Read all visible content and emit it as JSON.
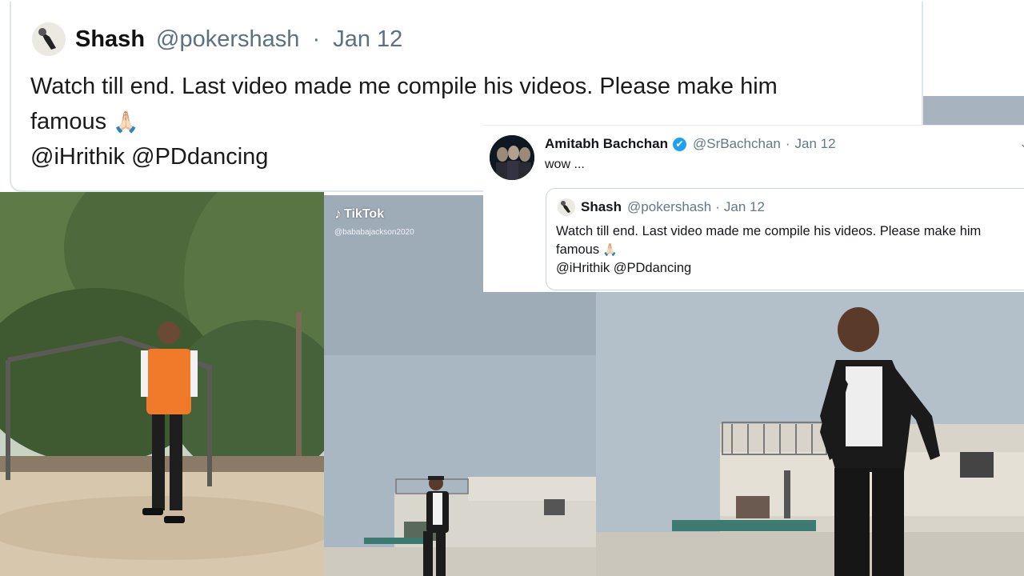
{
  "main_tweet": {
    "author_name": "Shash",
    "author_handle": "@pokershash",
    "separator": "·",
    "date": "Jan 12",
    "text": "Watch till end. Last video made me compile his videos. Please make him",
    "text_line2": "famous",
    "emoji": "🙏🏻",
    "mentions": [
      "@iHrithik",
      "@PDdancing"
    ]
  },
  "amitabh_tweet": {
    "author_name": "Amitabh Bachchan",
    "verified_icon": "✔",
    "author_handle": "@SrBachchan",
    "separator": "·",
    "date": "Jan 12",
    "text": "wow ...",
    "menu_icon": "chevron-down-icon",
    "quoted": {
      "author_name": "Shash",
      "author_handle": "@pokershash",
      "separator": "·",
      "date": "Jan 12",
      "text": "Watch till end. Last video made me compile his videos. Please make him",
      "text_line2": "famous",
      "emoji": "🙏🏻",
      "mentions": [
        "@iHrithik",
        "@PDdancing"
      ]
    }
  },
  "video_overlay": {
    "app_name": "TikTok",
    "app_icon": "♪",
    "user_handle": "@bababajackson2020"
  },
  "colors": {
    "sky": "#a9b7c2",
    "tree_green": "#4e6a3c",
    "dirt": "#d7c7ad",
    "orange_vest": "#f07a2a",
    "twitter_blue": "#1da1f2",
    "meta_gray": "#657786"
  }
}
